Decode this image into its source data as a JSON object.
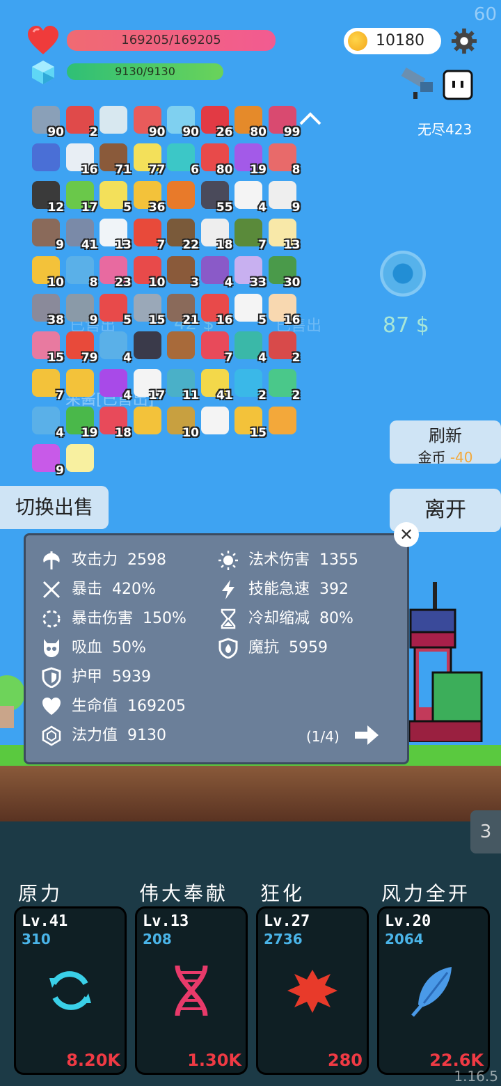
{
  "fps": "60",
  "version": "1.16.5",
  "hp": {
    "text": "169205/169205"
  },
  "mp": {
    "text": "9130/9130"
  },
  "coins": "10180",
  "endless": "无尽423",
  "items_row": [
    {
      "count": "90",
      "color": "#8aa0b8"
    },
    {
      "count": "2",
      "color": "#e04a4a"
    },
    {
      "count": "",
      "color": "#d8e8f0"
    },
    {
      "count": "90",
      "color": "#e85b5b"
    },
    {
      "count": "90",
      "color": "#7fd0f0"
    },
    {
      "count": "26",
      "color": "#e23a44"
    },
    {
      "count": "80",
      "color": "#e58a2a"
    },
    {
      "count": "99",
      "color": "#d94a70"
    },
    {
      "count": "",
      "color": "#4a6fd6"
    },
    {
      "count": "16",
      "color": "#e8eef4"
    },
    {
      "count": "71",
      "color": "#8a5a3a"
    },
    {
      "count": "77",
      "color": "#f3e05a"
    },
    {
      "count": "6",
      "color": "#3cc7c7"
    },
    {
      "count": "80",
      "color": "#e84a4a"
    },
    {
      "count": "19",
      "color": "#a35ae8"
    },
    {
      "count": "8",
      "color": "#e86a6a"
    },
    {
      "count": "12",
      "color": "#3a3a3a"
    },
    {
      "count": "17",
      "color": "#6ac84a"
    },
    {
      "count": "5",
      "color": "#f3e05a"
    },
    {
      "count": "36",
      "color": "#f3c23a"
    },
    {
      "count": "",
      "color": "#e87a2a"
    },
    {
      "count": "55",
      "color": "#4a4a5a"
    },
    {
      "count": "4",
      "color": "#f4f4f4"
    },
    {
      "count": "9",
      "color": "#eeeeee"
    },
    {
      "count": "9",
      "color": "#8a6a5a"
    },
    {
      "count": "41",
      "color": "#7a8aa8"
    },
    {
      "count": "13",
      "color": "#f0f4f8"
    },
    {
      "count": "7",
      "color": "#e84a3a"
    },
    {
      "count": "22",
      "color": "#7a5a3a"
    },
    {
      "count": "18",
      "color": "#eeeeee"
    },
    {
      "count": "7",
      "color": "#5a8a3a"
    },
    {
      "count": "13",
      "color": "#f8e8a8"
    },
    {
      "count": "10",
      "color": "#f3c23a"
    },
    {
      "count": "8",
      "color": "#5ab0e8"
    },
    {
      "count": "23",
      "color": "#e86aa0"
    },
    {
      "count": "10",
      "color": "#e84a4a"
    },
    {
      "count": "3",
      "color": "#8a5a3a"
    },
    {
      "count": "4",
      "color": "#8a5ac8"
    },
    {
      "count": "33",
      "color": "#c8b0f0"
    },
    {
      "count": "30",
      "color": "#4a9a4a"
    },
    {
      "count": "38",
      "color": "#8a8a9a"
    },
    {
      "count": "9",
      "color": "#8a9aa8"
    },
    {
      "count": "5",
      "color": "#e84a4a"
    },
    {
      "count": "15",
      "color": "#9aa8b8"
    },
    {
      "count": "21",
      "color": "#8a6a5a"
    },
    {
      "count": "16",
      "color": "#e84a4a"
    },
    {
      "count": "5",
      "color": "#f4f4f4"
    },
    {
      "count": "16",
      "color": "#f8d8b0"
    },
    {
      "count": "15",
      "color": "#e87aa0"
    },
    {
      "count": "79",
      "color": "#e84a3a"
    },
    {
      "count": "4",
      "color": "#5ab0e8"
    },
    {
      "count": "",
      "color": "#3a3a4a"
    },
    {
      "count": "",
      "color": "#a86a3a"
    },
    {
      "count": "7",
      "color": "#e84a5a"
    },
    {
      "count": "4",
      "color": "#3ab8a8"
    },
    {
      "count": "2",
      "color": "#d84a4a"
    },
    {
      "count": "7",
      "color": "#f3c23a"
    },
    {
      "count": "",
      "color": "#f3c23a"
    },
    {
      "count": "4",
      "color": "#a84ae8"
    },
    {
      "count": "17",
      "color": "#f4f4f4"
    },
    {
      "count": "11",
      "color": "#4ab0c8"
    },
    {
      "count": "41",
      "color": "#f3d84a"
    },
    {
      "count": "2",
      "color": "#3ab8e8"
    },
    {
      "count": "2",
      "color": "#4ac88a"
    },
    {
      "count": "4",
      "color": "#5ab0e8"
    },
    {
      "count": "19",
      "color": "#4ab84a"
    },
    {
      "count": "18",
      "color": "#e84a5a"
    },
    {
      "count": "",
      "color": "#f3c23a"
    },
    {
      "count": "10",
      "color": "#c8a040"
    },
    {
      "count": "",
      "color": "#f4f4f4"
    },
    {
      "count": "15",
      "color": "#f3c23a"
    },
    {
      "count": "",
      "color": "#f3a83a"
    },
    {
      "count": "9",
      "color": "#c85ae8"
    },
    {
      "count": "",
      "color": "#f8f0a0"
    }
  ],
  "buttons": {
    "refresh_title": "刷新",
    "refresh_cost_label": "金币",
    "refresh_cost_value": "-40",
    "leave": "离开",
    "switch": "切换出售"
  },
  "shop": {
    "price": "87 $",
    "sold1": "已售出",
    "sold2": "已售出",
    "price2": "42 $",
    "hidden_label": "采酱[已售出]"
  },
  "stats_left": [
    {
      "label": "攻击力",
      "value": "2598",
      "icon": "axe-icon"
    },
    {
      "label": "暴击",
      "value": "420%",
      "icon": "crit-icon"
    },
    {
      "label": "暴击伤害",
      "value": "150%",
      "icon": "crit-damage-icon"
    },
    {
      "label": "吸血",
      "value": "50%",
      "icon": "lifesteal-skull-icon"
    },
    {
      "label": "护甲",
      "value": "5939",
      "icon": "armor-shield-icon"
    },
    {
      "label": "生命值",
      "value": "169205",
      "icon": "heart-icon"
    },
    {
      "label": "法力值",
      "value": "9130",
      "icon": "mana-gem-icon"
    }
  ],
  "stats_right": [
    {
      "label": "法术伤害",
      "value": "1355",
      "icon": "sun-icon"
    },
    {
      "label": "技能急速",
      "value": "392",
      "icon": "lightning-icon"
    },
    {
      "label": "冷却缩减",
      "value": "80%",
      "icon": "hourglass-icon"
    },
    {
      "label": "魔抗",
      "value": "5959",
      "icon": "magic-shield-icon"
    }
  ],
  "stats_page": "(1/4)",
  "side_counter": "3",
  "skills": [
    {
      "title": "原力",
      "level": "Lv.41",
      "value": "310",
      "cost": "8.20K",
      "icon": "cycle-icon"
    },
    {
      "title": "伟大奉献",
      "level": "Lv.13",
      "value": "208",
      "cost": "1.30K",
      "icon": "dna-icon"
    },
    {
      "title": "狂化",
      "level": "Lv.27",
      "value": "2736",
      "cost": "280",
      "icon": "splat-icon"
    },
    {
      "title": "风力全开",
      "level": "Lv.20",
      "value": "2064",
      "cost": "22.6K",
      "icon": "feather-icon"
    }
  ]
}
